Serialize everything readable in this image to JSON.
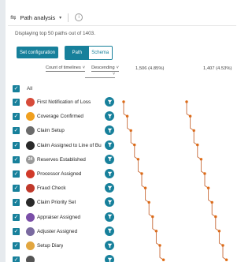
{
  "header": {
    "title": "Path analysis",
    "caret": "▾",
    "info": "i"
  },
  "subtitle": "Displaying top 50 paths out of 1403.",
  "buttons": {
    "config": "Set configuration"
  },
  "view_toggle": {
    "options": [
      "Path",
      "Schema"
    ],
    "active": "Path"
  },
  "sort": {
    "field": "Count of timelines",
    "order": "Descending",
    "secondary": ""
  },
  "columns": [
    {
      "label": "1,506 (4.85%)"
    },
    {
      "label": "1,407 (4.53%)"
    }
  ],
  "all_label": "All",
  "colors": {
    "accent": "#17809b",
    "path_line": "#c86c3c",
    "path_dot": "#e06a10"
  },
  "rows": [
    {
      "label": "First Notification of Loss",
      "icon": "red-circle-icon",
      "icon_color": "#d74b3a",
      "glyph": ""
    },
    {
      "label": "Coverage Confirmed",
      "icon": "hand-icon",
      "icon_color": "#f0a020",
      "glyph": ""
    },
    {
      "label": "Claim Setup",
      "icon": "clipboard-icon",
      "icon_color": "#6b6b6b",
      "glyph": ""
    },
    {
      "label": "Claim Assigned to Line of Business",
      "icon": "person-icon",
      "icon_color": "#2a2a2a",
      "glyph": ""
    },
    {
      "label": "Reserves Established",
      "icon": "badge-24-icon",
      "icon_color": "#9a9a9a",
      "glyph": "24"
    },
    {
      "label": "Processor Assigned",
      "icon": "processor-icon",
      "icon_color": "#d13a2a",
      "glyph": ""
    },
    {
      "label": "Fraud Check",
      "icon": "no-entry-icon",
      "icon_color": "#c0392b",
      "glyph": ""
    },
    {
      "label": "Claim Priority Set",
      "icon": "priority-icon",
      "icon_color": "#2a2a2a",
      "glyph": ""
    },
    {
      "label": "Appraiser Assigned",
      "icon": "appraiser-icon",
      "icon_color": "#7b4fa8",
      "glyph": ""
    },
    {
      "label": "Adjuster Assigned",
      "icon": "adjuster-icon",
      "icon_color": "#7a6aa0",
      "glyph": ""
    },
    {
      "label": "Setup Diary",
      "icon": "diary-icon",
      "icon_color": "#e2a640",
      "glyph": ""
    },
    {
      "label": "",
      "icon": "person-icon",
      "icon_color": "#555555",
      "glyph": ""
    }
  ]
}
